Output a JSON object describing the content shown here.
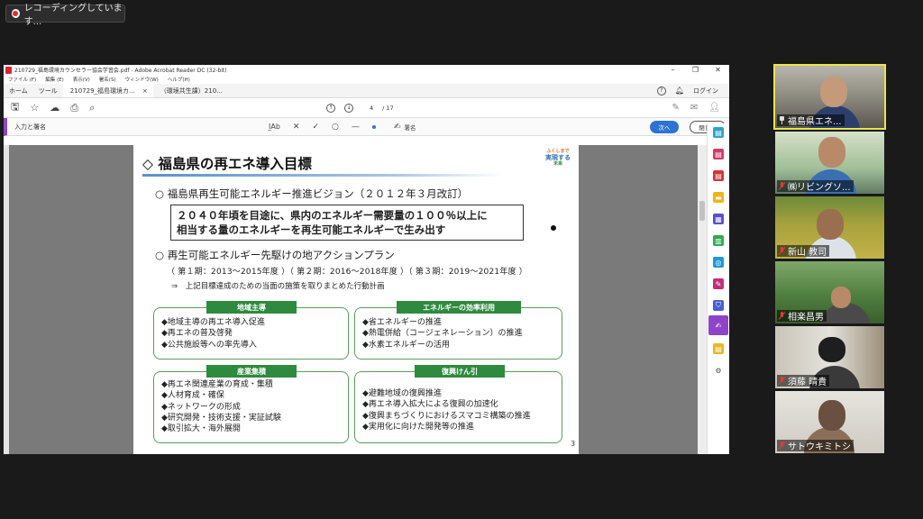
{
  "recording": {
    "label": "レコーディングしています..."
  },
  "acrobat": {
    "title": "210729_福島環境カウンセラー協会学習会.pdf - Adobe Acrobat Reader DC (32-bit)",
    "menu": [
      "ファイル (F)",
      "編集 (E)",
      "表示(V)",
      "署名(S)",
      "ウィンドウ(W)",
      "ヘルプ(H)"
    ],
    "tabs": {
      "home": "ホーム",
      "tools": "ツール",
      "doc1": "210729_福島環境カ...",
      "doc2": "（環境共生課）210..."
    },
    "login": "ログイン",
    "page_current": "4",
    "page_total": "/ 17",
    "signbar": {
      "label": "入力と署名",
      "sign": "署名",
      "next": "次へ",
      "close": "閉じる"
    }
  },
  "slide": {
    "title": "◇ 福島県の再エネ導入目標",
    "item1": "○ 福島県再生可能エネルギー推進ビジョン（２０１２年３月改訂）",
    "goal_line1": "２０４０年頃を目途に、県内のエネルギー需要量の１００％以上に",
    "goal_line2": "相当する量のエネルギーを再生可能エネルギーで生み出す",
    "item2": "○ 再生可能エネルギー先駆けの地アクションプラン",
    "periods": "（ 第１期：2013～2015年度 ）（ 第２期：2016～2018年度 ）（ 第３期：2019～2021年度 ）",
    "arrow_line": "⇒　上記目標達成のための当面の施策を取りまとめた行動計画",
    "panels": {
      "p1": {
        "title": "地域主導",
        "items": [
          "◆地域主導の再エネ導入促進",
          "◆再エネの普及啓発",
          "◆公共施設等への率先導入"
        ]
      },
      "p2": {
        "title": "エネルギーの効率利用",
        "items": [
          "◆省エネルギーの推進",
          "◆熱電併給（コージェネレーション）の推進",
          "◆水素エネルギーの活用"
        ]
      },
      "p3": {
        "title": "産業集積",
        "items": [
          "◆再エネ関連産業の育成・集積",
          "◆人材育成・確保",
          "◆ネットワークの形成",
          "◆研究開発・技術支援・実証試験",
          "◆取引拡大・海外展開"
        ]
      },
      "p4": {
        "title": "復興けん引",
        "items": [
          "◆避難地域の復興推進",
          "◆再エネ導入拡大による復興の加速化",
          "◆復興まちづくりにおけるスマコミ構築の推進",
          "◆実用化に向けた開発等の推進"
        ]
      }
    },
    "logo": {
      "l1": "ふくしまで",
      "l2": "実現する",
      "l3": "未来"
    },
    "page_number": "3"
  },
  "participants": [
    {
      "name": "福島県エネ...",
      "state": "pinned"
    },
    {
      "name": "㈱リビングソ...",
      "state": "muted"
    },
    {
      "name": "新山 教司",
      "state": "muted"
    },
    {
      "name": "相楽昌男",
      "state": "muted"
    },
    {
      "name": "須藤 晴貴",
      "state": "muted"
    },
    {
      "name": "サトウキミトシ",
      "state": "muted"
    }
  ]
}
